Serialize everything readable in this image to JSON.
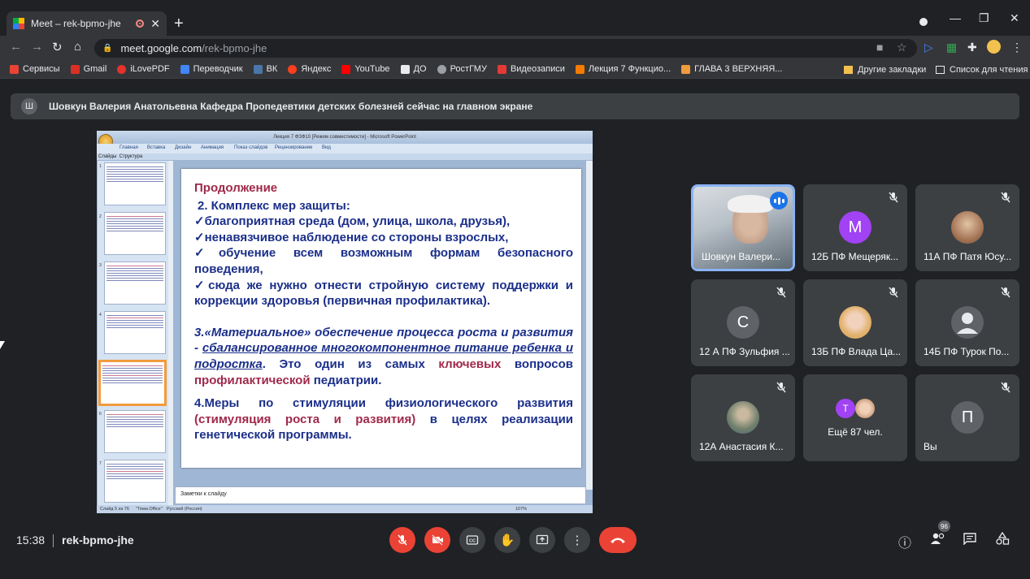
{
  "browser": {
    "tab_title": "Meet – rek-bpmo-jhe",
    "url_host": "meet.google.com",
    "url_path": "/rek-bpmo-jhe",
    "bookmarks": [
      {
        "label": "Сервисы",
        "color": "#ea4335"
      },
      {
        "label": "Gmail",
        "color": "#d93025"
      },
      {
        "label": "iLovePDF",
        "color": "#e5322d"
      },
      {
        "label": "Переводчик",
        "color": "#4285f4"
      },
      {
        "label": "ВК",
        "color": "#4a76a8"
      },
      {
        "label": "Яндекс",
        "color": "#fc3f1d"
      },
      {
        "label": "YouTube",
        "color": "#ff0000"
      },
      {
        "label": "ДО",
        "color": "#e8eaed"
      },
      {
        "label": "РостГМУ",
        "color": "#9aa0a6"
      },
      {
        "label": "Видеозаписи",
        "color": "#e53935"
      },
      {
        "label": "Лекция 7 Функцио...",
        "color": "#f57c00"
      },
      {
        "label": "ГЛАВА 3 ВЕРХНЯЯ...",
        "color": "#f29b3c"
      }
    ],
    "bookmarks_other": "Другие закладки",
    "reading_list": "Список для чтения"
  },
  "banner": {
    "avatar": "Ш",
    "text": "Шовкун Валерия Анатольевна Кафедра Пропедевтики детских болезней сейчас на главном экране"
  },
  "presentation": {
    "window_title": "Лекция 7 ФЗФ10 [Режим совместимости] - Microsoft PowerPoint",
    "ribbon_tabs": [
      "Главная",
      "Вставка",
      "Дизайн",
      "Анимация",
      "Показ слайдов",
      "Рецензирование",
      "Вид"
    ],
    "side_tabs": [
      "Слайды",
      "Структура"
    ],
    "thumb_numbers": [
      "1",
      "2",
      "3",
      "4",
      "5",
      "6",
      "7"
    ],
    "notes_placeholder": "Заметки к слайду",
    "status_slide": "Слайд 5 из 76",
    "status_theme": "\"Тема Office\"",
    "status_lang": "Русский (Россия)",
    "status_zoom": "107%",
    "slide": {
      "heading": "Продолжение",
      "item2": "2. Комплекс мер защиты:",
      "bullets": [
        "✓благоприятная  среда  (дом, улица, школа, друзья),",
        "✓ненавязчивое наблюдение  со стороны взрослых,",
        "✓обучение  всем  возможным  формам  безопасного поведения,",
        "✓сюда же нужно отнести стройную систему поддержки и коррекции здоровья (первичная  профилактика)."
      ],
      "item3_lead": "3.«Материальное» обеспечение процесса роста и развития -",
      "item3_link": "сбалансированное многокомпонентное питание ребенка и подростка",
      "item3_rest": ". Это один   из самых",
      "item3_key": "ключевых",
      "item3_mid": "вопросов",
      "item3_prof": "профилактической",
      "item3_end": "педиатрии.",
      "item4_lead": "4.Меры по стимуляции   физиологического развития",
      "item4_paren": "(стимуляция роста и развития)",
      "item4_end": "в целях реализации генетической программы."
    }
  },
  "participants": [
    {
      "name": "Шовкун Валери...",
      "type": "video",
      "speaking": true
    },
    {
      "name": "12Б ПФ Мещеряк...",
      "initial": "M",
      "color": "#a142f4"
    },
    {
      "name": "11А ПФ Патя Юсу...",
      "type": "photo",
      "color": "#c98a5a"
    },
    {
      "name": "12 А ПФ Зульфия ...",
      "initial": "С",
      "color": "#5f6368"
    },
    {
      "name": "13Б ПФ Влада Ца...",
      "type": "photo",
      "color": "#e6b87a"
    },
    {
      "name": "14Б ПФ Турок По...",
      "type": "person",
      "color": "#5f6368"
    },
    {
      "name": "12А Анастасия К...",
      "type": "photo",
      "color": "#7a8a7a"
    },
    {
      "name": "Ещё 87 чел.",
      "type": "more",
      "extra_initial": "T",
      "extra_color": "#a142f4"
    },
    {
      "name": "Вы",
      "initial": "П",
      "color": "#5f6368"
    }
  ],
  "bottom": {
    "time": "15:38",
    "meeting_code": "rek-bpmo-jhe",
    "participant_count": "96"
  }
}
